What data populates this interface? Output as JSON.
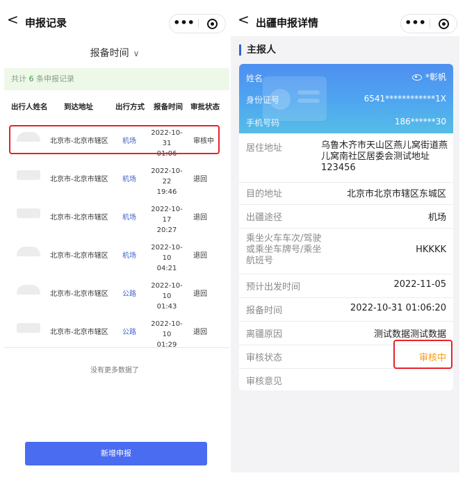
{
  "left": {
    "nav": {
      "back": "<",
      "title": "申报记录",
      "more": "•••"
    },
    "filter": {
      "label": "报备时间",
      "chevron": "∨"
    },
    "count": {
      "prefix": "共计",
      "num": "6",
      "suffix": "条申报记录"
    },
    "headers": [
      "出行人姓名",
      "到达地址",
      "出行方式",
      "报备时间",
      "审批状态"
    ],
    "rows": [
      {
        "addr": "北京市-北京市辖区",
        "mode": "机场",
        "date": "2022-10-31",
        "time": "01:06",
        "status": "审核中"
      },
      {
        "addr": "北京市-北京市辖区",
        "mode": "机场",
        "date": "2022-10-22",
        "time": "19:46",
        "status": "退回"
      },
      {
        "addr": "北京市-北京市辖区",
        "mode": "机场",
        "date": "2022-10-17",
        "time": "20:27",
        "status": "退回"
      },
      {
        "addr": "北京市-北京市辖区",
        "mode": "机场",
        "date": "2022-10-10",
        "time": "04:21",
        "status": "退回"
      },
      {
        "addr": "北京市-北京市辖区",
        "mode": "公路",
        "date": "2022-10-10",
        "time": "01:43",
        "status": "退回"
      },
      {
        "addr": "北京市-北京市辖区",
        "mode": "公路",
        "date": "2022-10-10",
        "time": "01:29",
        "status": "退回"
      }
    ],
    "no_more": "没有更多数据了",
    "new_button": "新增申报"
  },
  "right": {
    "nav": {
      "back": "<",
      "title": "出疆申报详情",
      "more": "•••"
    },
    "section_title": "主报人",
    "card": {
      "name_label": "姓名",
      "name_value": "*彰帆",
      "id_label": "身份证号",
      "id_value": "6541************1X",
      "phone_label": "手机号码",
      "phone_value": "186******30"
    },
    "info": [
      {
        "label": "居住地址",
        "value": "乌鲁木齐市天山区燕儿窝街道燕儿窝南社区居委会测试地址123456"
      },
      {
        "label": "目的地址",
        "value": "北京市北京市辖区东城区"
      },
      {
        "label": "出疆途径",
        "value": "机场"
      },
      {
        "label": "乘坐火车车次/驾驶或乘坐车牌号/乘坐航班号",
        "value": "HKKKK"
      },
      {
        "label": "预计出发时间",
        "value": "2022-11-05"
      },
      {
        "label": "报备时间",
        "value": "2022-10-31 01:06:20"
      },
      {
        "label": "离疆原因",
        "value": "测试数据测试数据"
      },
      {
        "label": "审核状态",
        "value": "审核中"
      },
      {
        "label": "审核意见",
        "value": ""
      }
    ],
    "accent_color": "#2f63d6",
    "status_color": "#f39c1a"
  },
  "colors": {
    "highlight": "#e3222a",
    "button": "#4a6cf0",
    "link": "#3f5fc9"
  }
}
